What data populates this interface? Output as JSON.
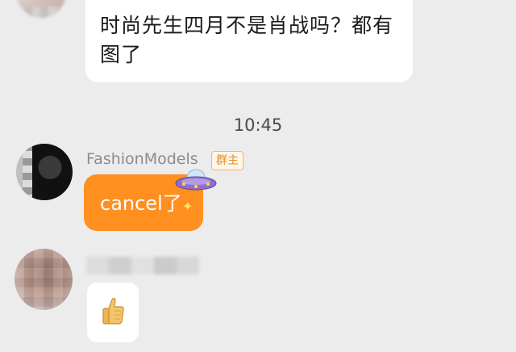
{
  "messages": [
    {
      "text": "时尚先生四月不是肖战吗？都有图了"
    },
    {
      "sender": "FashionModels",
      "role_badge": "群主",
      "text": "cancel了",
      "sparkle": "✦"
    }
  ],
  "timestamp": "10:45",
  "icons": {
    "ufo": "ufo-icon",
    "thumbs_up": "thumbs-up-icon"
  },
  "colors": {
    "background": "#ececec",
    "orange_bubble": "#ff8f1f",
    "badge": "#e58a1f"
  }
}
